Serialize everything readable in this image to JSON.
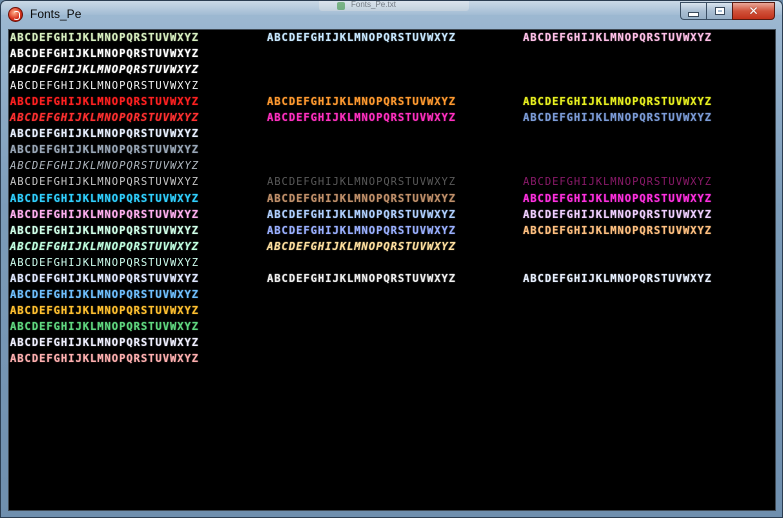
{
  "window": {
    "title": "Fonts_Pe",
    "background_window_title": "Fonts_Pe.txt",
    "controls": {
      "minimize_label": "—",
      "maximize_label": "",
      "close_label": "✕"
    },
    "icon": "red-circle-app-icon"
  },
  "client": {
    "background": "#000000",
    "sample_text": "ABCDEFGHIJKLMNOPQRSTUVWXYZ",
    "rows": [
      {
        "row": 0,
        "items": [
          {
            "col": 0,
            "text": "ABCDEFGHIJKLMNOPQRSTUVWXYZ",
            "color": "#d8f0c0",
            "weight": "bold"
          },
          {
            "col": 1,
            "text": "ABCDEFGHIJKLMNOPQRSTUVWXYZ",
            "color": "#c8e8ff",
            "weight": "bold"
          },
          {
            "col": 2,
            "text": "ABCDEFGHIJKLMNOPQRSTUVWXYZ",
            "color": "#ffc0e8",
            "weight": "bold"
          }
        ]
      },
      {
        "row": 1,
        "items": [
          {
            "col": 0,
            "text": "ABCDEFGHIJKLMNOPQRSTUVWXYZ",
            "color": "#ffffff",
            "weight": "bold"
          }
        ]
      },
      {
        "row": 2,
        "items": [
          {
            "col": 0,
            "text": "ABCDEFGHIJKLMNOPQRSTUVWXYZ",
            "color": "#ffffff",
            "weight": "bold",
            "italic": true
          }
        ]
      },
      {
        "row": 3,
        "items": [
          {
            "col": 0,
            "text": "ABCDEFGHIJKLMNOPQRSTUVWXYZ",
            "color": "#f4f4f4",
            "weight": "normal"
          }
        ]
      },
      {
        "row": 4,
        "items": [
          {
            "col": 0,
            "text": "ABCDEFGHIJKLMNOPQRSTUVWXYZ",
            "color": "#ff2020",
            "weight": "bold"
          },
          {
            "col": 1,
            "text": "ABCDEFGHIJKLMNOPQRSTUVWXYZ",
            "color": "#ff9a30",
            "weight": "bold"
          },
          {
            "col": 2,
            "text": "ABCDEFGHIJKLMNOPQRSTUVWXYZ",
            "color": "#e8f020",
            "weight": "bold"
          }
        ]
      },
      {
        "row": 5,
        "items": [
          {
            "col": 0,
            "text": "ABCDEFGHIJKLMNOPQRSTUVWXYZ",
            "color": "#ff3030",
            "weight": "bold",
            "italic": true
          },
          {
            "col": 1,
            "text": "ABCDEFGHIJKLMNOPQRSTUVWXYZ",
            "color": "#ff30c0",
            "weight": "bold"
          },
          {
            "col": 2,
            "text": "ABCDEFGHIJKLMNOPQRSTUVWXYZ",
            "color": "#7c9cd8",
            "weight": "bold"
          }
        ]
      },
      {
        "row": 6,
        "items": [
          {
            "col": 0,
            "text": "ABCDEFGHIJKLMNOPQRSTUVWXYZ",
            "color": "#e8f0ff",
            "weight": "bold"
          }
        ]
      },
      {
        "row": 7,
        "items": [
          {
            "col": 0,
            "text": "ABCDEFGHIJKLMNOPQRSTUVWXYZ",
            "color": "#9aa8b8",
            "weight": "bold"
          }
        ]
      },
      {
        "row": 8,
        "items": [
          {
            "col": 0,
            "text": "ABCDEFGHIJKLMNOPQRSTUVWXYZ",
            "color": "#b0b8c0",
            "weight": "normal",
            "italic": true
          }
        ]
      },
      {
        "row": 9,
        "items": [
          {
            "col": 0,
            "text": "ABCDEFGHIJKLMNOPQRSTUVWXYZ",
            "color": "#c8c8c8",
            "weight": "normal"
          },
          {
            "col": 1,
            "text": "ABCDEFGHIJKLMNOPQRSTUVWXYZ",
            "color": "#5a5a5a",
            "weight": "normal"
          },
          {
            "col": 2,
            "text": "ABCDEFGHIJKLMNOPQRSTUVWXYZ",
            "color": "#8a1a6a",
            "weight": "normal"
          }
        ]
      },
      {
        "row": 10,
        "items": [
          {
            "col": 0,
            "text": "ABCDEFGHIJKLMNOPQRSTUVWXYZ",
            "color": "#30d0ff",
            "weight": "bold"
          },
          {
            "col": 1,
            "text": "ABCDEFGHIJKLMNOPQRSTUVWXYZ",
            "color": "#c0906a",
            "weight": "bold"
          },
          {
            "col": 2,
            "text": "ABCDEFGHIJKLMNOPQRSTUVWXYZ",
            "color": "#ff30e0",
            "weight": "bold"
          }
        ]
      },
      {
        "row": 11,
        "items": [
          {
            "col": 0,
            "text": "ABCDEFGHIJKLMNOPQRSTUVWXYZ",
            "color": "#ffb0f0",
            "weight": "bold"
          },
          {
            "col": 1,
            "text": "ABCDEFGHIJKLMNOPQRSTUVWXYZ",
            "color": "#b0d0ff",
            "weight": "bold"
          },
          {
            "col": 2,
            "text": "ABCDEFGHIJKLMNOPQRSTUVWXYZ",
            "color": "#f0d0ff",
            "weight": "bold"
          }
        ]
      },
      {
        "row": 12,
        "items": [
          {
            "col": 0,
            "text": "ABCDEFGHIJKLMNOPQRSTUVWXYZ",
            "color": "#d0ffe8",
            "weight": "bold"
          },
          {
            "col": 1,
            "text": "ABCDEFGHIJKLMNOPQRSTUVWXYZ",
            "color": "#9ab0ff",
            "weight": "bold"
          },
          {
            "col": 2,
            "text": "ABCDEFGHIJKLMNOPQRSTUVWXYZ",
            "color": "#ffc080",
            "weight": "bold"
          }
        ]
      },
      {
        "row": 13,
        "items": [
          {
            "col": 0,
            "text": "ABCDEFGHIJKLMNOPQRSTUVWXYZ",
            "color": "#c0ffe0",
            "weight": "bold",
            "italic": true
          },
          {
            "col": 1,
            "text": "ABCDEFGHIJKLMNOPQRSTUVWXYZ",
            "color": "#ffe0a0",
            "weight": "bold",
            "italic": true
          }
        ]
      },
      {
        "row": 14,
        "items": [
          {
            "col": 0,
            "text": "ABCDEFGHIJKLMNOPQRSTUVWXYZ",
            "color": "#d0fff0",
            "weight": "normal"
          }
        ]
      },
      {
        "row": 15,
        "items": [
          {
            "col": 0,
            "text": "ABCDEFGHIJKLMNOPQRSTUVWXYZ",
            "color": "#e0e8ff",
            "weight": "bold"
          },
          {
            "col": 1,
            "text": "ABCDEFGHIJKLMNOPQRSTUVWXYZ",
            "color": "#f0f0f0",
            "weight": "bold"
          },
          {
            "col": 2,
            "text": "ABCDEFGHIJKLMNOPQRSTUVWXYZ",
            "color": "#e8f0ff",
            "weight": "bold"
          }
        ]
      },
      {
        "row": 16,
        "items": [
          {
            "col": 0,
            "text": "ABCDEFGHIJKLMNOPQRSTUVWXYZ",
            "color": "#70c0ff",
            "weight": "bold"
          }
        ]
      },
      {
        "row": 17,
        "items": [
          {
            "col": 0,
            "text": "ABCDEFGHIJKLMNOPQRSTUVWXYZ",
            "color": "#ffc030",
            "weight": "bold"
          }
        ]
      },
      {
        "row": 18,
        "items": [
          {
            "col": 0,
            "text": "ABCDEFGHIJKLMNOPQRSTUVWXYZ",
            "color": "#60d880",
            "weight": "bold"
          }
        ]
      },
      {
        "row": 19,
        "items": [
          {
            "col": 0,
            "text": "ABCDEFGHIJKLMNOPQRSTUVWXYZ",
            "color": "#f0f0ff",
            "weight": "bold"
          }
        ]
      },
      {
        "row": 20,
        "items": [
          {
            "col": 0,
            "text": "ABCDEFGHIJKLMNOPQRSTUVWXYZ",
            "color": "#ffb0b0",
            "weight": "bold"
          }
        ]
      }
    ]
  }
}
